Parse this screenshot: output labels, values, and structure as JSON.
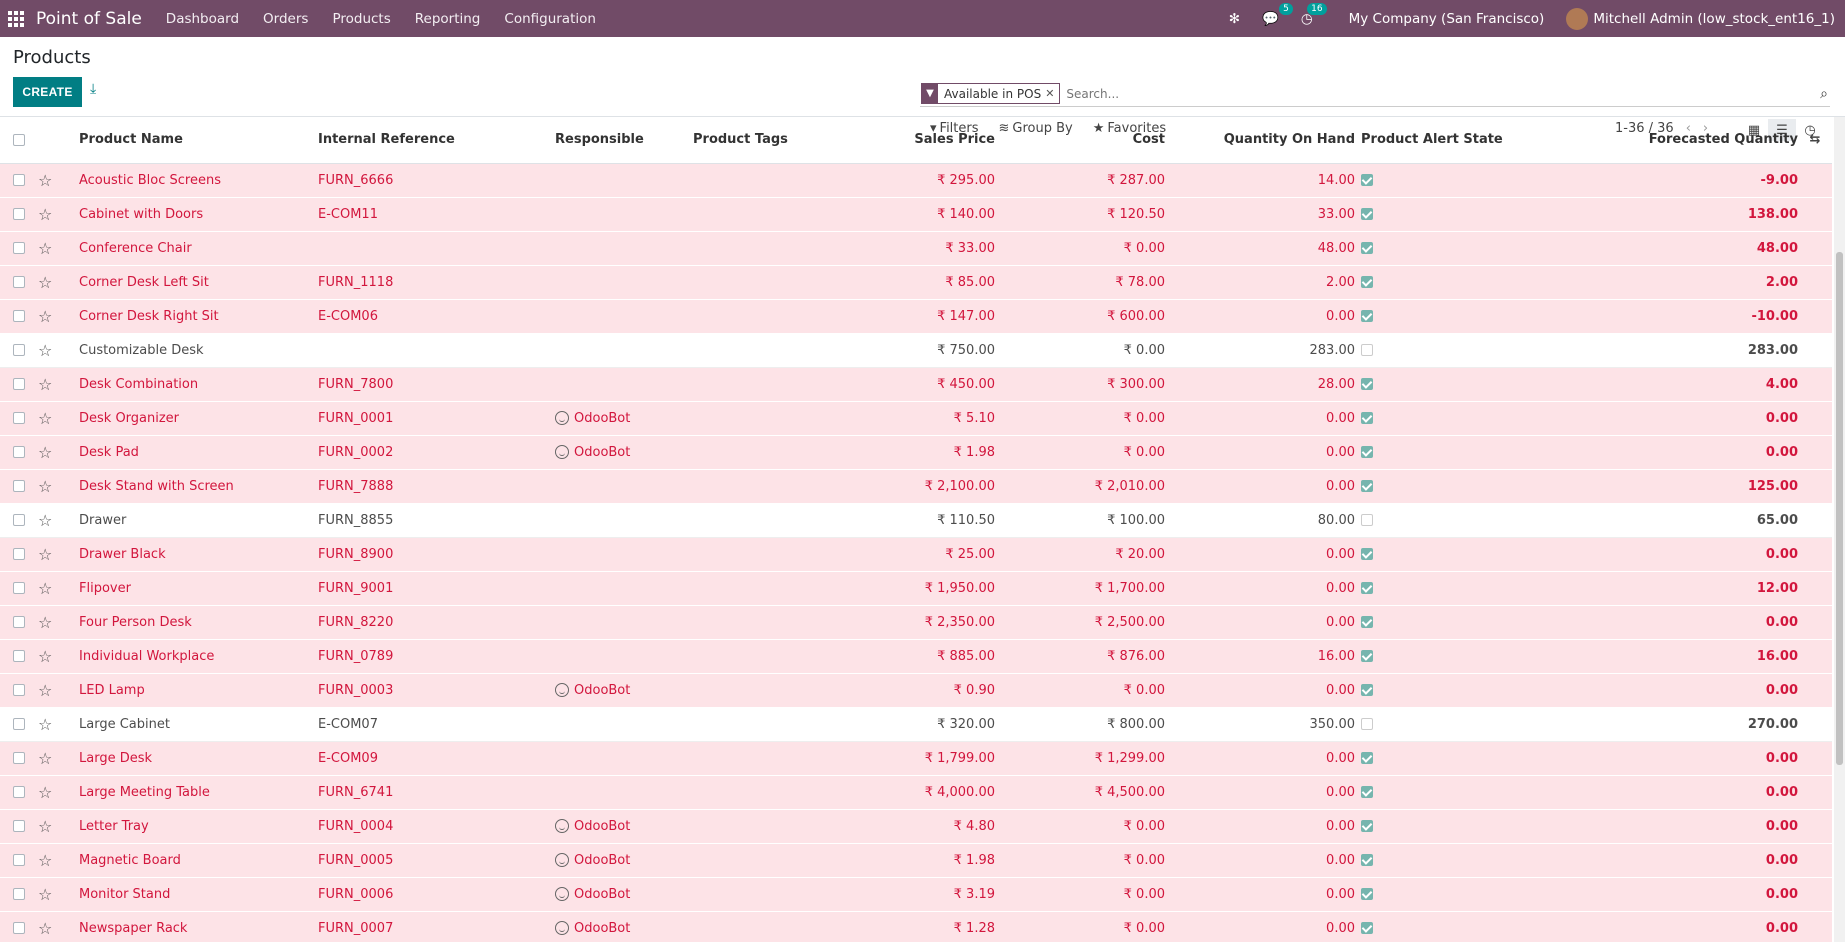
{
  "topbar": {
    "app_title": "Point of Sale",
    "menu": [
      "Dashboard",
      "Orders",
      "Products",
      "Reporting",
      "Configuration"
    ],
    "messages_count": "5",
    "activities_count": "16",
    "company": "My Company (San Francisco)",
    "user": "Mitchell Admin (low_stock_ent16_1)"
  },
  "control": {
    "title": "Products",
    "create_label": "CREATE",
    "facet_value": "Available in POS",
    "search_placeholder": "Search...",
    "filters_label": "Filters",
    "groupby_label": "Group By",
    "favorites_label": "Favorites",
    "pager": "1-36 / 36"
  },
  "columns": {
    "name": "Product Name",
    "ref": "Internal Reference",
    "responsible": "Responsible",
    "tags": "Product Tags",
    "price": "Sales Price",
    "cost": "Cost",
    "qty": "Quantity On Hand",
    "alert": "Product Alert State",
    "forecast": "Forecasted Quantity"
  },
  "rows": [
    {
      "name": "Acoustic Bloc Screens",
      "ref": "FURN_6666",
      "responsible": "",
      "price": "₹ 295.00",
      "cost": "₹ 287.00",
      "qty": "14.00",
      "alert": true,
      "forecast": "-9.00"
    },
    {
      "name": "Cabinet with Doors",
      "ref": "E-COM11",
      "responsible": "",
      "price": "₹ 140.00",
      "cost": "₹ 120.50",
      "qty": "33.00",
      "alert": true,
      "forecast": "138.00"
    },
    {
      "name": "Conference Chair",
      "ref": "",
      "responsible": "",
      "price": "₹ 33.00",
      "cost": "₹ 0.00",
      "qty": "48.00",
      "alert": true,
      "forecast": "48.00"
    },
    {
      "name": "Corner Desk Left Sit",
      "ref": "FURN_1118",
      "responsible": "",
      "price": "₹ 85.00",
      "cost": "₹ 78.00",
      "qty": "2.00",
      "alert": true,
      "forecast": "2.00"
    },
    {
      "name": "Corner Desk Right Sit",
      "ref": "E-COM06",
      "responsible": "",
      "price": "₹ 147.00",
      "cost": "₹ 600.00",
      "qty": "0.00",
      "alert": true,
      "forecast": "-10.00"
    },
    {
      "name": "Customizable Desk",
      "ref": "",
      "responsible": "",
      "price": "₹ 750.00",
      "cost": "₹ 0.00",
      "qty": "283.00",
      "alert": false,
      "forecast": "283.00"
    },
    {
      "name": "Desk Combination",
      "ref": "FURN_7800",
      "responsible": "",
      "price": "₹ 450.00",
      "cost": "₹ 300.00",
      "qty": "28.00",
      "alert": true,
      "forecast": "4.00"
    },
    {
      "name": "Desk Organizer",
      "ref": "FURN_0001",
      "responsible": "OdooBot",
      "price": "₹ 5.10",
      "cost": "₹ 0.00",
      "qty": "0.00",
      "alert": true,
      "forecast": "0.00"
    },
    {
      "name": "Desk Pad",
      "ref": "FURN_0002",
      "responsible": "OdooBot",
      "price": "₹ 1.98",
      "cost": "₹ 0.00",
      "qty": "0.00",
      "alert": true,
      "forecast": "0.00"
    },
    {
      "name": "Desk Stand with Screen",
      "ref": "FURN_7888",
      "responsible": "",
      "price": "₹ 2,100.00",
      "cost": "₹ 2,010.00",
      "qty": "0.00",
      "alert": true,
      "forecast": "125.00"
    },
    {
      "name": "Drawer",
      "ref": "FURN_8855",
      "responsible": "",
      "price": "₹ 110.50",
      "cost": "₹ 100.00",
      "qty": "80.00",
      "alert": false,
      "forecast": "65.00"
    },
    {
      "name": "Drawer Black",
      "ref": "FURN_8900",
      "responsible": "",
      "price": "₹ 25.00",
      "cost": "₹ 20.00",
      "qty": "0.00",
      "alert": true,
      "forecast": "0.00"
    },
    {
      "name": "Flipover",
      "ref": "FURN_9001",
      "responsible": "",
      "price": "₹ 1,950.00",
      "cost": "₹ 1,700.00",
      "qty": "0.00",
      "alert": true,
      "forecast": "12.00"
    },
    {
      "name": "Four Person Desk",
      "ref": "FURN_8220",
      "responsible": "",
      "price": "₹ 2,350.00",
      "cost": "₹ 2,500.00",
      "qty": "0.00",
      "alert": true,
      "forecast": "0.00"
    },
    {
      "name": "Individual Workplace",
      "ref": "FURN_0789",
      "responsible": "",
      "price": "₹ 885.00",
      "cost": "₹ 876.00",
      "qty": "16.00",
      "alert": true,
      "forecast": "16.00"
    },
    {
      "name": "LED Lamp",
      "ref": "FURN_0003",
      "responsible": "OdooBot",
      "price": "₹ 0.90",
      "cost": "₹ 0.00",
      "qty": "0.00",
      "alert": true,
      "forecast": "0.00"
    },
    {
      "name": "Large Cabinet",
      "ref": "E-COM07",
      "responsible": "",
      "price": "₹ 320.00",
      "cost": "₹ 800.00",
      "qty": "350.00",
      "alert": false,
      "forecast": "270.00"
    },
    {
      "name": "Large Desk",
      "ref": "E-COM09",
      "responsible": "",
      "price": "₹ 1,799.00",
      "cost": "₹ 1,299.00",
      "qty": "0.00",
      "alert": true,
      "forecast": "0.00"
    },
    {
      "name": "Large Meeting Table",
      "ref": "FURN_6741",
      "responsible": "",
      "price": "₹ 4,000.00",
      "cost": "₹ 4,500.00",
      "qty": "0.00",
      "alert": true,
      "forecast": "0.00"
    },
    {
      "name": "Letter Tray",
      "ref": "FURN_0004",
      "responsible": "OdooBot",
      "price": "₹ 4.80",
      "cost": "₹ 0.00",
      "qty": "0.00",
      "alert": true,
      "forecast": "0.00"
    },
    {
      "name": "Magnetic Board",
      "ref": "FURN_0005",
      "responsible": "OdooBot",
      "price": "₹ 1.98",
      "cost": "₹ 0.00",
      "qty": "0.00",
      "alert": true,
      "forecast": "0.00"
    },
    {
      "name": "Monitor Stand",
      "ref": "FURN_0006",
      "responsible": "OdooBot",
      "price": "₹ 3.19",
      "cost": "₹ 0.00",
      "qty": "0.00",
      "alert": true,
      "forecast": "0.00"
    },
    {
      "name": "Newspaper Rack",
      "ref": "FURN_0007",
      "responsible": "OdooBot",
      "price": "₹ 1.28",
      "cost": "₹ 0.00",
      "qty": "0.00",
      "alert": true,
      "forecast": "0.00"
    }
  ]
}
